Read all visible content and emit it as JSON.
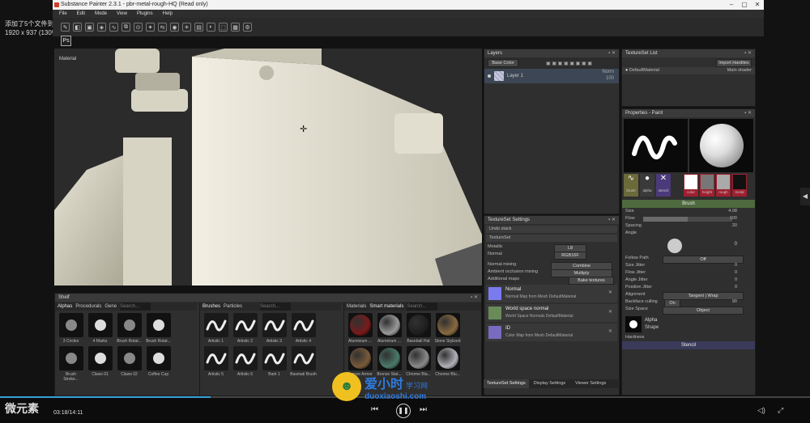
{
  "overlay": {
    "line1": "添加了5个文件到列表",
    "line2": "1920 x 937 (130%)"
  },
  "app": {
    "title": "Substance Painter 2.3.1 - pbr-metal-rough-HQ (Read only)"
  },
  "menu": [
    "File",
    "Edit",
    "Mode",
    "View",
    "Plugins",
    "Help"
  ],
  "viewport": {
    "label": "Material"
  },
  "layers": {
    "title": "Layers",
    "blend_mode": "Base Color",
    "layer_name": "Layer 1",
    "layer_blend": "Norm",
    "layer_opacity": "100"
  },
  "texture_set_list": {
    "title": "TextureSet List",
    "import_button": "Import Hardites",
    "material": "DefaultMaterial",
    "shader": "Main shader"
  },
  "texture_set_settings": {
    "title": "TextureSet Settings",
    "undo_stack": "Undo stack",
    "texture_set": "TextureSet",
    "metallic_label": "Metallic",
    "metallic_value": "L8",
    "normal_label": "Normal",
    "normal_value": "RGB16F",
    "normal_mixing_label": "Normal mixing",
    "normal_mixing_value": "Combine",
    "ambient_occlusion_label": "Ambient occlusion mixing",
    "ambient_occlusion_value": "Multiply",
    "additional_maps_label": "Additional maps",
    "bake_button": "Bake textures",
    "maps": [
      {
        "name": "Normal",
        "desc": "Normal Map from Mesh DefaultMaterial",
        "color": "#7b7bf0"
      },
      {
        "name": "World space normal",
        "desc": "World Space Normals DefaultMaterial",
        "color": "#6a8a5a"
      },
      {
        "name": "ID",
        "desc": "Color Map from Mesh DefaultMaterial",
        "color": "#7a6ac0"
      }
    ]
  },
  "tabs_bottom": [
    "TextureSet Settings",
    "Display Settings",
    "Viewer Settings"
  ],
  "properties": {
    "title": "Properties - Paint",
    "channels": [
      "brush",
      "alpha",
      "stencil"
    ],
    "material_channels": [
      "color",
      "height",
      "rough",
      "metal"
    ],
    "brush_section": "Brush",
    "size_label": "Size",
    "size_value": "4.08",
    "flow_label": "Flow",
    "flow_value": "100",
    "spacing_label": "Spacing",
    "spacing_value": "20",
    "angle_label": "Angle",
    "angle_value": "0",
    "follow_path_label": "Follow Path",
    "follow_path_value": "Off",
    "size_jitter": "Size Jitter",
    "flow_jitter": "Flow Jitter",
    "angle_jitter": "Angle Jitter",
    "position_jitter": "Position Jitter",
    "jitter_value": "0",
    "alignment_label": "Alignment",
    "alignment_value": "Tangent | Wrap",
    "backface_label": "Backface culling",
    "backface_state": "On",
    "backface_value": "90",
    "size_space_label": "Size Space",
    "size_space_value": "Object",
    "alpha_label": "Alpha",
    "alpha_shape": "Shape",
    "hardness_label": "Hardness",
    "stencil_section": "Stencil"
  },
  "shelf": {
    "title": "Shelf",
    "tabs": [
      "Alphas",
      "Procedurals",
      "Gene"
    ],
    "search_placeholder": "Search...",
    "alphas": [
      "3 Circles",
      "4 Marks",
      "Brush Rotat...",
      "Brush Rotat...",
      "Brush Stroke...",
      "Claws 01",
      "Claws 02",
      "Coffee Cup"
    ],
    "brush_tabs": [
      "Brushes",
      "Particles"
    ],
    "brushes": [
      "Artistic 1",
      "Artistic 2",
      "Artistic 3",
      "Artistic 4",
      "Artistic 5",
      "Artistic 6",
      "Bark 1",
      "Basmati Brush"
    ],
    "material_tabs": [
      "Materials",
      "Smart materials"
    ],
    "materials": [
      "Aluminium ...",
      "Aluminium ...",
      "Baseball Hat",
      "Stone Stylized",
      "Bronze Armor",
      "Bronze Stat...",
      "Chrome Bla...",
      "Chrome Blu..."
    ],
    "material_colors": [
      "#7a1a1a",
      "#9a9a9a",
      "#1e1e1e",
      "#8a6a40",
      "#7a5a3a",
      "#4a7a6a",
      "#8a8a8a",
      "#b0b0b8"
    ]
  },
  "statusbar": {
    "time": "03:18/14:11",
    "brand": "微元素",
    "watermark": "爱小时",
    "watermark_url": "duoxiaoshi.com",
    "watermark_sub": "学习网"
  },
  "playback": {
    "progress": 0.26
  }
}
